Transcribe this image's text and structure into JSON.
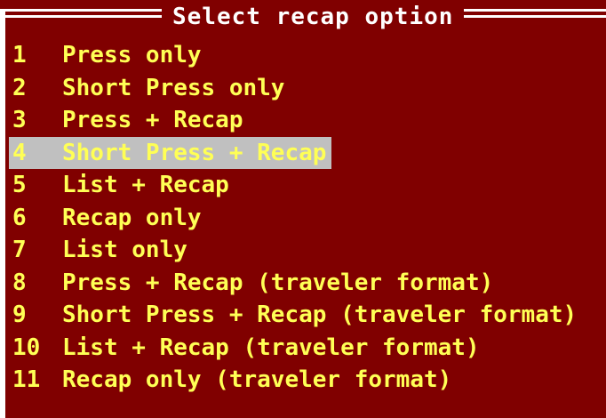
{
  "dialog": {
    "title": "Select recap option",
    "colors": {
      "background": "#800000",
      "text": "#ffff55",
      "frame": "#ffffff",
      "selection": "#c0c0c0"
    }
  },
  "options": [
    {
      "number": "1",
      "label": "Press only"
    },
    {
      "number": "2",
      "label": "Short Press only"
    },
    {
      "number": "3",
      "label": "Press + Recap"
    },
    {
      "number": "4",
      "label": "Short Press + Recap",
      "selected": true
    },
    {
      "number": "5",
      "label": "List + Recap"
    },
    {
      "number": "6",
      "label": "Recap only"
    },
    {
      "number": "7",
      "label": "List only"
    },
    {
      "number": "8",
      "label": "Press + Recap (traveler format)"
    },
    {
      "number": "9",
      "label": "Short Press + Recap (traveler format)"
    },
    {
      "number": "10",
      "label": "List + Recap (traveler format)"
    },
    {
      "number": "11",
      "label": "Recap only (traveler format)"
    }
  ]
}
